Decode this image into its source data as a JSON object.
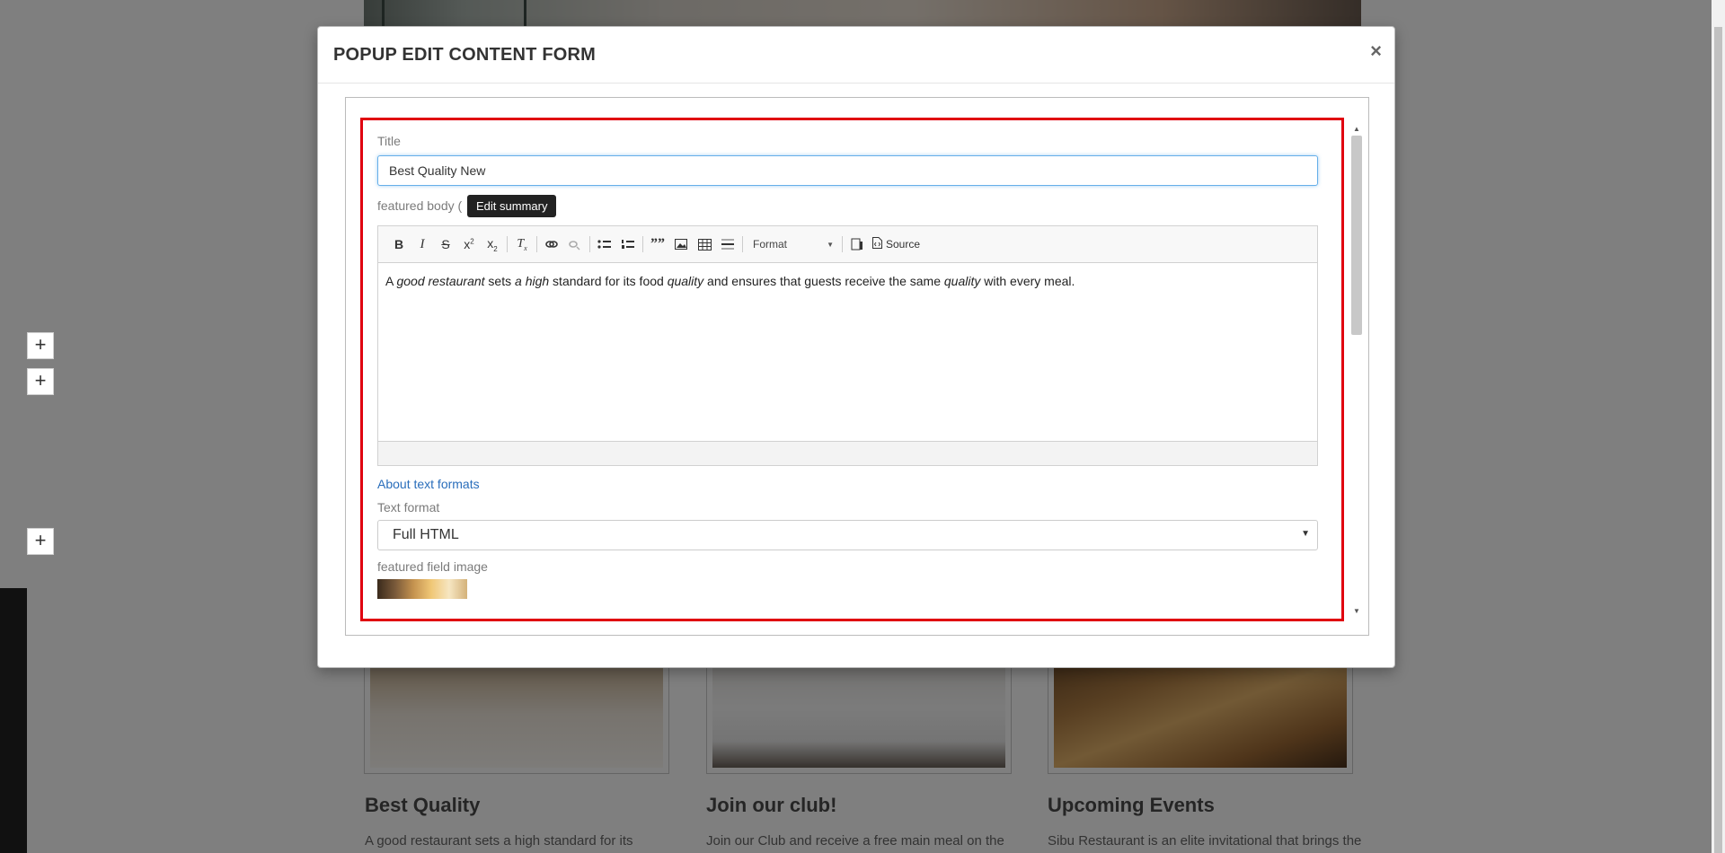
{
  "background": {
    "cards": [
      {
        "heading": "Best Quality",
        "text": "A good restaurant sets a high standard for its"
      },
      {
        "heading": "Join our club!",
        "text": "Join our Club and receive a free main meal on the"
      },
      {
        "heading": "Upcoming Events",
        "text": "Sibu Restaurant is an elite invitational that brings the"
      }
    ],
    "side_buttons": [
      "+",
      "+",
      "+"
    ]
  },
  "modal": {
    "title": "POPUP EDIT CONTENT FORM",
    "close_glyph": "×"
  },
  "form": {
    "title_label": "Title",
    "title_value": "Best Quality New",
    "body_label": "featured body (",
    "body_label_end": ")",
    "tooltip": "Edit summary",
    "toolbar": {
      "format_label": "Format",
      "source_label": "Source",
      "icons": [
        "bold-icon",
        "italic-icon",
        "strikethrough-icon",
        "superscript-icon",
        "subscript-icon",
        "remove-format-icon",
        "link-icon",
        "unlink-icon",
        "bulleted-list-icon",
        "numbered-list-icon",
        "blockquote-icon",
        "image-icon",
        "table-icon",
        "horizontal-line-icon",
        "maximize-icon",
        "source-icon"
      ]
    },
    "editor_text": {
      "p1": "A ",
      "p2": "good restaurant",
      "p3": " sets ",
      "p4": "a high",
      "p5": " standard for its food ",
      "p6": "quality",
      "p7": " and ensures that guests receive the same ",
      "p8": "quality",
      "p9": " with every meal."
    },
    "about_link": "About text formats",
    "text_format_label": "Text format",
    "text_format_value": "Full HTML",
    "image_label": "featured field image"
  },
  "colors": {
    "highlight_frame": "#e0000f",
    "link": "#2a6ebb",
    "focus": "#66afe9"
  }
}
